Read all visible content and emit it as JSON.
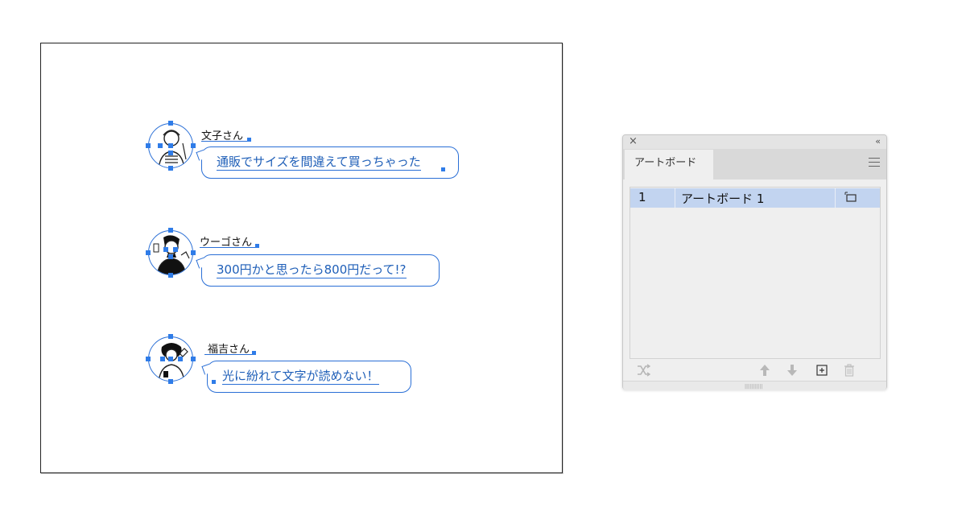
{
  "artboard": {
    "rows": [
      {
        "name": "文子さん",
        "message": "通販でサイズを間違えて買っちゃった"
      },
      {
        "name": "ウーゴさん",
        "message": "300円かと思ったら800円だって!?"
      },
      {
        "name": "福吉さん",
        "message": "光に紛れて文字が読めない！"
      }
    ]
  },
  "panel": {
    "title": "アートボード",
    "rows": [
      {
        "number": "1",
        "label": "アートボード 1"
      }
    ],
    "icons": {
      "close": "close-icon",
      "collapse": "collapse-icon",
      "menu": "menu-icon",
      "rearrange": "rearrange-icon",
      "move_up": "arrow-up-icon",
      "move_down": "arrow-down-icon",
      "new_artboard": "new-artboard-icon",
      "delete": "trash-icon"
    },
    "colors": {
      "selected_row": "#c2d4f0",
      "selection": "#2f7ce8"
    }
  },
  "symbols": {
    "close": "×",
    "collapse": "‹‹",
    "grip": "|||||||||||"
  }
}
